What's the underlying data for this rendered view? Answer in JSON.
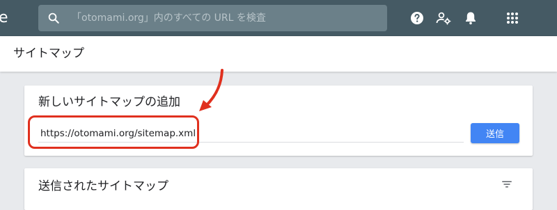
{
  "topbar": {
    "logo_fragment": "e",
    "search": {
      "placeholder": "「otomami.org」内のすべての URL を検査"
    },
    "icons": [
      "help-icon",
      "account-settings-icon",
      "notifications-icon",
      "apps-grid-icon"
    ]
  },
  "page": {
    "title": "サイトマップ"
  },
  "add_sitemap": {
    "title": "新しいサイトマップの追加",
    "url_value": "https://otomami.org/sitemap.xml",
    "submit_label": "送信"
  },
  "submitted_sitemaps": {
    "title": "送信されたサイトマップ",
    "icon": "filter-icon"
  },
  "annotation": {
    "color": "#e0301e"
  },
  "colors": {
    "topbar": "#455a64",
    "button": "#4285f4"
  }
}
